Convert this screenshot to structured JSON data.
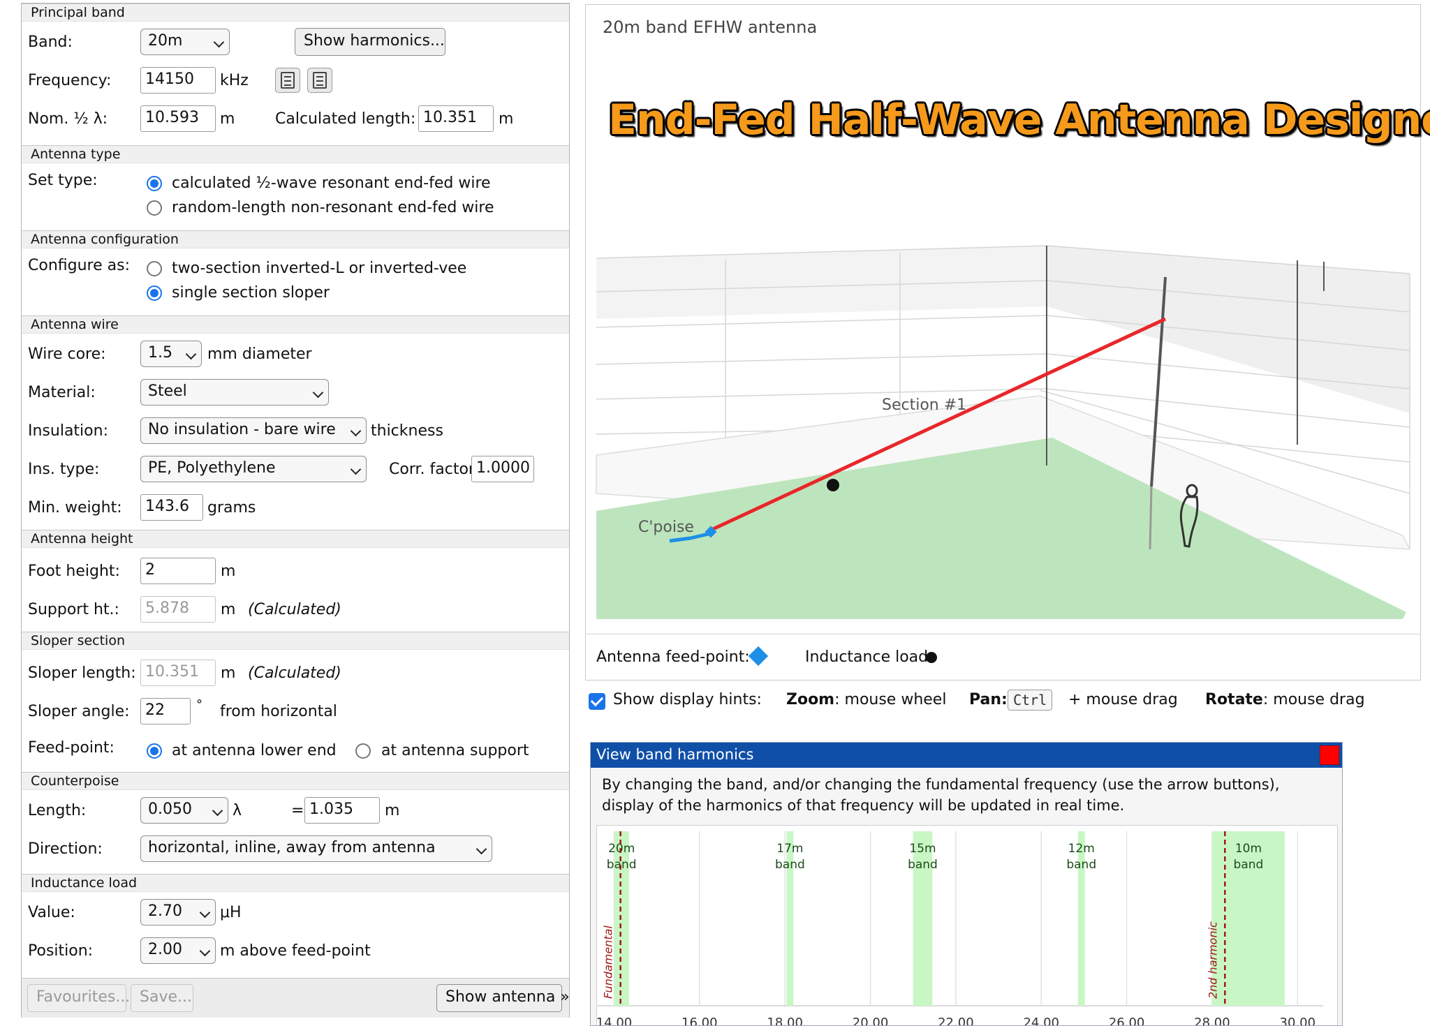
{
  "principal_band": {
    "section": "Principal band",
    "band_label": "Band:",
    "band_value": "20m",
    "show_harmonics": "Show harmonics...",
    "freq_label": "Frequency:",
    "freq_value": "14150",
    "freq_unit": "kHz",
    "nom_label": "Nom. ½ λ:",
    "nom_value": "10.593",
    "nom_unit": "m",
    "calc_label": "Calculated length:",
    "calc_value": "10.351",
    "calc_unit": "m"
  },
  "antenna_type": {
    "section": "Antenna type",
    "label": "Set type:",
    "opt1": "calculated ½-wave resonant end-fed wire",
    "opt2": "random-length non-resonant end-fed wire",
    "selected": 1
  },
  "antenna_config": {
    "section": "Antenna configuration",
    "label": "Configure as:",
    "opt1": "two-section inverted-L or inverted-vee",
    "opt2": "single section sloper",
    "selected": 2
  },
  "antenna_wire": {
    "section": "Antenna wire",
    "core_label": "Wire core:",
    "core_value": "1.5",
    "core_unit": "mm  diameter",
    "material_label": "Material:",
    "material_value": "Steel",
    "insulation_label": "Insulation:",
    "insulation_value": "No insulation - bare wire",
    "insulation_unit": "thickness",
    "instype_label": "Ins. type:",
    "instype_value": "PE, Polyethylene",
    "corr_label": "Corr. factor:",
    "corr_value": "1.0000",
    "minweight_label": "Min. weight:",
    "minweight_value": "143.6",
    "minweight_unit": "grams"
  },
  "antenna_height": {
    "section": "Antenna height",
    "foot_label": "Foot height:",
    "foot_value": "2",
    "foot_unit": "m",
    "support_label": "Support ht.:",
    "support_value": "5.878",
    "support_unit": "m",
    "support_note": "(Calculated)"
  },
  "sloper_section": {
    "section": "Sloper section",
    "length_label": "Sloper length:",
    "length_value": "10.351",
    "length_unit": "m",
    "length_note": "(Calculated)",
    "angle_label": "Sloper angle:",
    "angle_value": "22",
    "angle_unit": "°",
    "angle_note": "from horizontal",
    "feed_label": "Feed-point:",
    "feed_opt1": "at antenna lower end",
    "feed_opt2": "at antenna support",
    "feed_selected": 1
  },
  "counterpoise": {
    "section": "Counterpoise",
    "length_label": "Length:",
    "length_value": "0.050",
    "length_unit": "λ",
    "eq": "=",
    "meters_value": "1.035",
    "meters_unit": "m",
    "direction_label": "Direction:",
    "direction_value": "horizontal, inline, away from antenna"
  },
  "inductance_load": {
    "section": "Inductance load",
    "value_label": "Value:",
    "value_value": "2.70",
    "value_unit": "μH",
    "position_label": "Position:",
    "position_value": "2.00",
    "position_unit": "m above feed-point"
  },
  "bottom": {
    "favourites": "Favourites...",
    "save": "Save...",
    "show_antenna": "Show antenna »"
  },
  "view": {
    "title": "20m band EFHW antenna",
    "banner": "End-Fed Half-Wave Antenna Designer",
    "section_label": "Section #1",
    "cpoise_label": "C'poise",
    "colors": {
      "antenna": "#e8272a",
      "counterpoise": "#1e8fe6",
      "ground": "#bde5bd",
      "feed": "#1e8fe6"
    }
  },
  "legend": {
    "feed": "Antenna feed-point:",
    "load": "Inductance load:"
  },
  "hints": {
    "show_label": "Show display hints:",
    "checked": true,
    "zoom_key": "Zoom",
    "zoom_desc": ": mouse wheel",
    "pan_key": "Pan",
    "pan_colon": ":",
    "pan_kbd": "Ctrl",
    "pan_desc": "+ mouse drag",
    "rotate_key": "Rotate",
    "rotate_desc": ": mouse drag"
  },
  "harmonics_dialog": {
    "title": "View band harmonics",
    "text1": "By changing the band, and/or changing the fundamental frequency (use the arrow buttons),",
    "text2": "display of the harmonics of that frequency will be updated in real time."
  },
  "chart_data": {
    "type": "bar",
    "title": "",
    "xlim": [
      13.6,
      30.6
    ],
    "x_ticks": [
      "14.00",
      "16.00",
      "18.00",
      "20.00",
      "22.00",
      "24.00",
      "26.00",
      "28.00",
      "30.00"
    ],
    "bands": [
      {
        "name": "20m",
        "label2": "band",
        "start": 14.0,
        "end": 14.35
      },
      {
        "name": "17m",
        "label2": "band",
        "start": 18.068,
        "end": 18.168
      },
      {
        "name": "15m",
        "label2": "band",
        "start": 21.0,
        "end": 21.45
      },
      {
        "name": "12m",
        "label2": "band",
        "start": 24.89,
        "end": 24.99
      },
      {
        "name": "10m",
        "label2": "band",
        "start": 28.0,
        "end": 29.7
      }
    ],
    "harmonics": [
      {
        "label": "Fundamental",
        "freq": 14.15
      },
      {
        "label": "2nd harmonic",
        "freq": 28.3
      }
    ]
  }
}
